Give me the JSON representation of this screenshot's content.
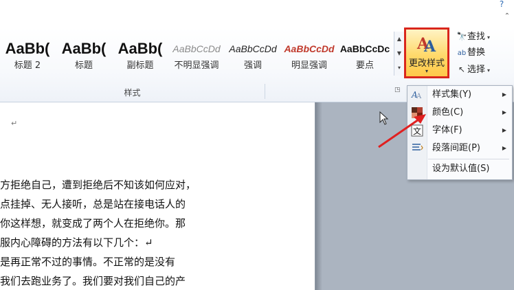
{
  "window": {
    "help_icon": "help-icon",
    "collapse_icon": "chevron-up-icon"
  },
  "ribbon": {
    "styles": [
      {
        "preview": "AaBb(",
        "name": "标题 2"
      },
      {
        "preview": "AaBb(",
        "name": "标题"
      },
      {
        "preview": "AaBb(",
        "name": "副标题"
      },
      {
        "preview": "AaBbCcDd",
        "name": "不明显强调"
      },
      {
        "preview": "AaBbCcDd",
        "name": "强调"
      },
      {
        "preview": "AaBbCcDd",
        "name": "明显强调"
      },
      {
        "preview": "AaBbCcDc",
        "name": "要点"
      }
    ],
    "styles_group_label": "样式",
    "change_styles": {
      "label": "更改样式",
      "arrow": "▾"
    },
    "editing": {
      "find_label": "查找",
      "replace_label": "替换",
      "select_label": "选择"
    },
    "colors": {
      "highlight_border": "#d9261c",
      "intense_emphasis": "#c0392b"
    }
  },
  "document": {
    "empty_paragraph_mark": "↵",
    "lines": [
      "方拒绝自己，遭到拒绝后不知该如何应对，",
      "点挂掉、无人接听，总是站在接电话人的",
      "你这样想，就变成了两个人在拒绝你。那",
      "服内心障碍的方法有以下几个：↵",
      "是再正常不过的事情。不正常的是没有",
      "我们去跑业务了。我们要对我们自己的产"
    ]
  },
  "menu": {
    "items": [
      {
        "label": "样式集(Y)",
        "icon": "style-set-icon",
        "has_submenu": true
      },
      {
        "label": "颜色(C)",
        "icon": "color-palette-icon",
        "has_submenu": true
      },
      {
        "label": "字体(F)",
        "icon": "font-icon",
        "has_submenu": true
      },
      {
        "label": "段落间距(P)",
        "icon": "paragraph-spacing-icon",
        "has_submenu": true
      },
      {
        "label": "设为默认值(S)",
        "icon": "",
        "has_submenu": false
      }
    ]
  },
  "annotation": {
    "color": "#e02020"
  }
}
